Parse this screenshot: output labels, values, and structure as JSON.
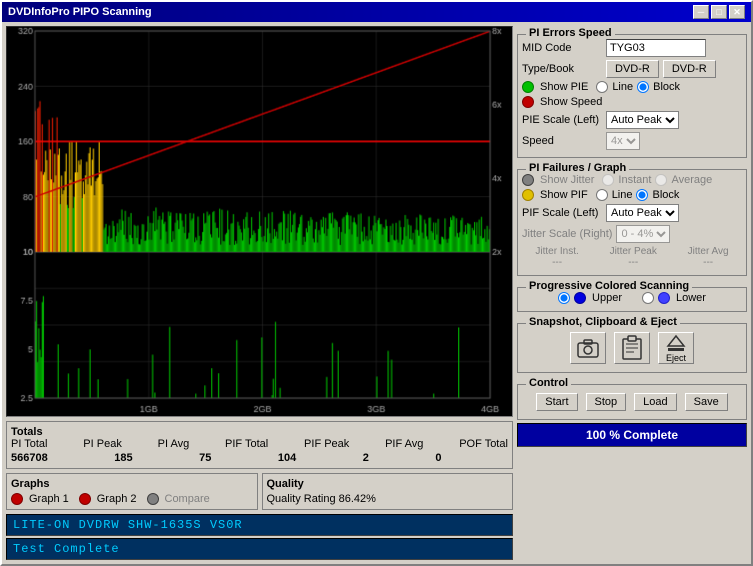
{
  "window": {
    "title": "DVDInfoPro PIPO Scanning",
    "min_btn": "─",
    "max_btn": "□",
    "close_btn": "✕"
  },
  "pi_errors": {
    "section_title": "PI Errors  Speed",
    "mid_code_label": "MID Code",
    "mid_code_value": "TYG03",
    "type_book_label": "Type/Book",
    "type_book_val1": "DVD-R",
    "type_book_val2": "DVD-R",
    "show_pie_label": "Show PIE",
    "show_pie_line": "Line",
    "show_pie_block": "Block",
    "show_speed_label": "Show Speed",
    "pie_scale_label": "PIE Scale (Left)",
    "pie_scale_value": "Auto Peak",
    "speed_label": "Speed",
    "speed_value": "4x"
  },
  "pi_failures": {
    "section_title": "PI Failures / Graph",
    "show_jitter_label": "Show Jitter",
    "instant_label": "Instant",
    "average_label": "Average",
    "show_pif_label": "Show PIF",
    "pif_line_label": "Line",
    "pif_block_label": "Block",
    "pif_scale_label": "PIF Scale (Left)",
    "pif_scale_value": "Auto Peak",
    "jitter_scale_label": "Jitter Scale (Right)",
    "jitter_scale_value": "0 - 4%",
    "jitter_inst_label": "Jitter Inst.",
    "jitter_peak_label": "Jitter Peak",
    "jitter_avg_label": "Jitter Avg",
    "jitter_inst_value": "---",
    "jitter_peak_value": "---",
    "jitter_avg_value": "---"
  },
  "progressive": {
    "section_title": "Progressive Colored Scanning",
    "upper_label": "Upper",
    "lower_label": "Lower"
  },
  "snapshot": {
    "section_title": "Snapshot, Clipboard  & Eject",
    "eject_label": "Eject"
  },
  "control": {
    "section_title": "Control",
    "start_label": "Start",
    "stop_label": "Stop",
    "load_label": "Load",
    "save_label": "Save"
  },
  "progress": {
    "text": "100 % Complete"
  },
  "totals": {
    "section_title": "Totals",
    "pi_total_label": "PI Total",
    "pi_peak_label": "PI Peak",
    "pi_avg_label": "PI Avg",
    "pif_total_label": "PIF Total",
    "pif_peak_label": "PIF Peak",
    "pif_avg_label": "PIF Avg",
    "pof_total_label": "POF Total",
    "pi_total_value": "566708",
    "pi_peak_value": "185",
    "pi_avg_value": "75",
    "pif_total_value": "104",
    "pif_peak_value": "2",
    "pif_avg_value": "0",
    "pof_total_value": ""
  },
  "graphs": {
    "section_title": "Graphs",
    "graph1_label": "Graph 1",
    "graph2_label": "Graph 2",
    "compare_label": "Compare"
  },
  "quality": {
    "section_title": "Quality",
    "rating_label": "Quality Rating 86.42%"
  },
  "lcd": {
    "line1": "LITE-ON DVDRW SHW-1635S VS0R",
    "line2": "Test Complete"
  },
  "chart": {
    "upper_y_labels": [
      "320",
      "240",
      "160",
      "80",
      "10"
    ],
    "lower_y_labels": [
      "10",
      "7.5",
      "5",
      "2.5"
    ],
    "x_labels": [
      "1GB",
      "2GB",
      "3GB",
      "4GB"
    ],
    "right_upper_labels": [
      "8x",
      "6x",
      "4x",
      "2x"
    ],
    "right_lower_labels": []
  }
}
